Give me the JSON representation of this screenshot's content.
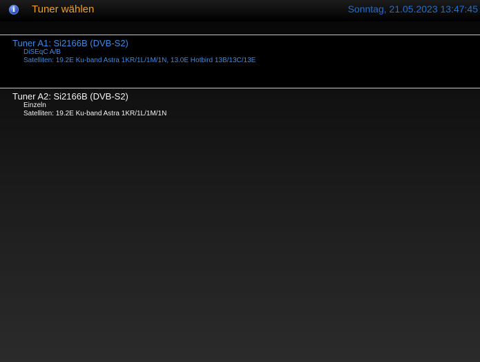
{
  "header": {
    "icon": "info-icon",
    "icon_glyph": "i",
    "title": "Tuner wählen",
    "datetime": "Sonntag, 21.05.2023 13:47:45"
  },
  "tuners": [
    {
      "name": "Tuner A1: Si2166B (DVB-S2)",
      "mode": "DiSEqC A/B",
      "satellites": "Satelliten: 19.2E Ku-band Astra 1KR/1L/1M/1N, 13.0E Hotbird 13B/13C/13E",
      "selected": true
    },
    {
      "name": "Tuner A2: Si2166B (DVB-S2)",
      "mode": "Einzeln",
      "satellites": "Satelliten: 19.2E Ku-band Astra 1KR/1L/1M/1N",
      "selected": false
    }
  ],
  "colors": {
    "title": "#f0a020",
    "datetime": "#1e6fd6",
    "selected_text": "#3a8de8",
    "normal_text": "#f2f2f2"
  }
}
